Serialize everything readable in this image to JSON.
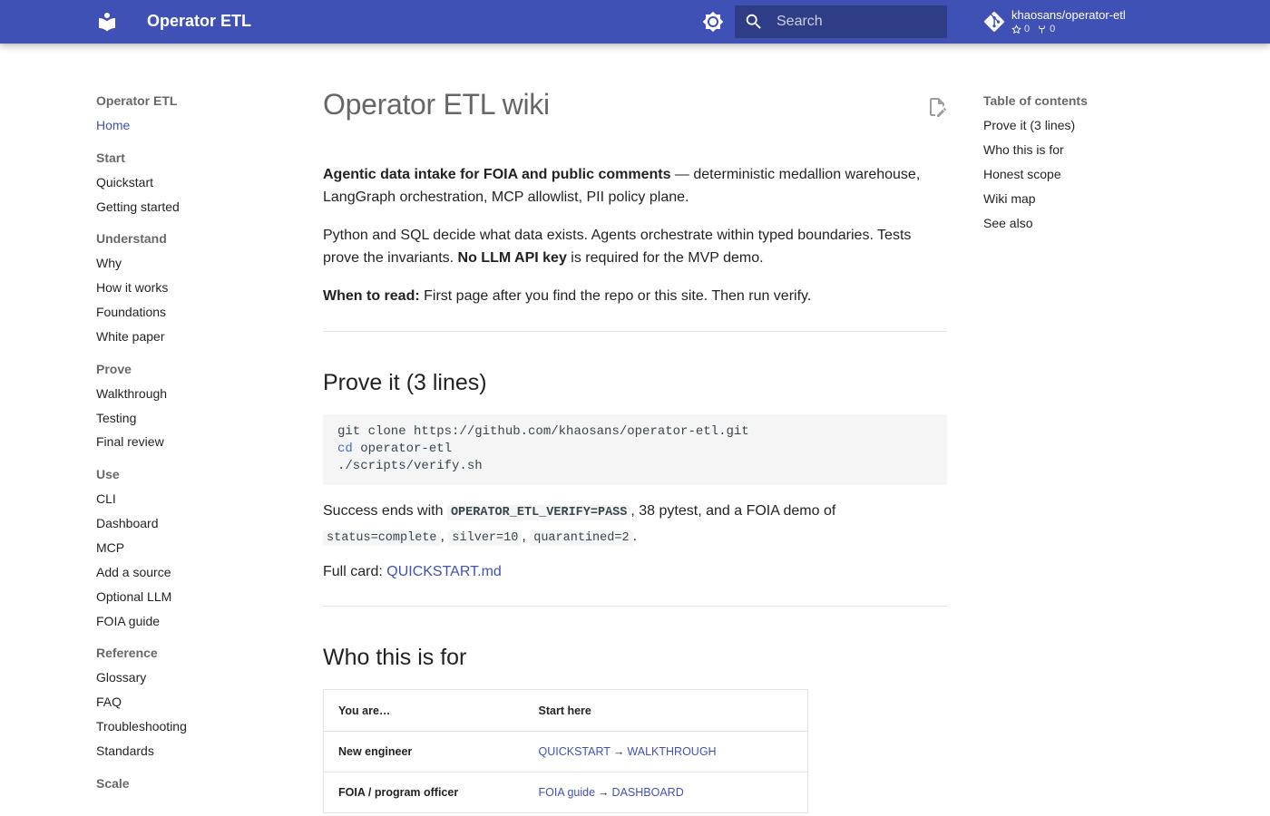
{
  "header": {
    "site_title": "Operator ETL",
    "search_placeholder": "Search",
    "repo_name": "khaosans/operator-etl",
    "stars": "0",
    "forks": "0",
    "brand_color": "#4051b5"
  },
  "nav": {
    "title": "Operator ETL",
    "home": "Home",
    "sections": [
      {
        "label": "Start",
        "items": [
          "Quickstart",
          "Getting started"
        ]
      },
      {
        "label": "Understand",
        "items": [
          "Why",
          "How it works",
          "Foundations",
          "White paper"
        ]
      },
      {
        "label": "Prove",
        "items": [
          "Walkthrough",
          "Testing",
          "Final review"
        ]
      },
      {
        "label": "Use",
        "items": [
          "CLI",
          "Dashboard",
          "MCP",
          "Add a source",
          "Optional LLM",
          "FOIA guide"
        ]
      },
      {
        "label": "Reference",
        "items": [
          "Glossary",
          "FAQ",
          "Troubleshooting",
          "Standards"
        ]
      },
      {
        "label": "Scale",
        "items": []
      }
    ]
  },
  "page": {
    "title": "Operator ETL wiki",
    "intro_bold": "Agentic data intake for FOIA and public comments",
    "intro_rest": " — deterministic medallion warehouse, LangGraph orchestration, MCP allowlist, PII policy plane.",
    "p2_a": "Python and SQL decide what data exists. Agents orchestrate within typed boundaries. Tests prove the invariants. ",
    "p2_bold": "No LLM API key",
    "p2_b": " is required for the MVP demo.",
    "p3_bold": "When to read:",
    "p3_rest": " First page after you find the repo or this site. Then run verify.",
    "h2_prove": "Prove it (3 lines)",
    "code_line1": "git clone https://github.com/khaosans/operator-etl.git",
    "code_line2_kw": "cd",
    "code_line2_rest": " operator-etl",
    "code_line3": "./scripts/verify.sh",
    "success_a": "Success ends with ",
    "success_code1": "OPERATOR_ETL_VERIFY=PASS",
    "success_b": ", 38 pytest, and a FOIA demo of",
    "success_code2": "status=complete",
    "comma1": ", ",
    "success_code3": "silver=10",
    "comma2": ", ",
    "success_code4": "quarantined=2",
    "period": ".",
    "fullcard_label": "Full card: ",
    "fullcard_link": "QUICKSTART.md",
    "h2_who": "Who this is for",
    "table": {
      "headers": [
        "You are…",
        "Start here"
      ],
      "rows": [
        {
          "who": "New engineer",
          "link1": "QUICKSTART",
          "link2": "WALKTHROUGH"
        },
        {
          "who": "FOIA / program officer",
          "link1": "FOIA guide",
          "link2": "DASHBOARD"
        }
      ],
      "arrow": "→"
    }
  },
  "toc": {
    "title": "Table of contents",
    "items": [
      "Prove it (3 lines)",
      "Who this is for",
      "Honest scope",
      "Wiki map",
      "See also"
    ]
  }
}
